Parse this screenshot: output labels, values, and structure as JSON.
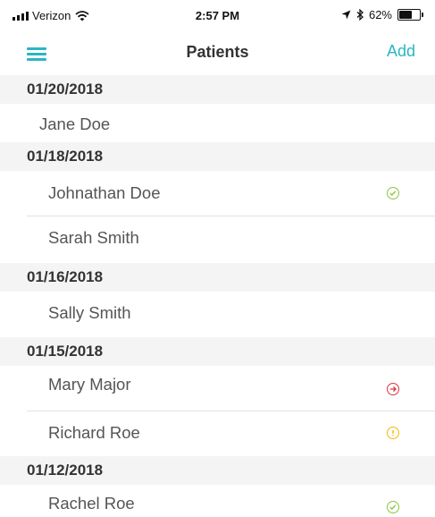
{
  "status_bar": {
    "carrier": "Verizon",
    "time": "2:57 PM",
    "battery": "62%",
    "battery_level": 0.62
  },
  "nav": {
    "title": "Patients",
    "add_label": "Add"
  },
  "sections": [
    {
      "date": "01/20/2018",
      "patients": [
        {
          "name": "Jane Doe",
          "status": "none"
        }
      ]
    },
    {
      "date": "01/18/2018",
      "patients": [
        {
          "name": "Johnathan Doe",
          "status": "check"
        },
        {
          "name": "Sarah Smith",
          "status": "none"
        }
      ]
    },
    {
      "date": "01/16/2018",
      "patients": [
        {
          "name": "Sally Smith",
          "status": "none"
        }
      ]
    },
    {
      "date": "01/15/2018",
      "patients": [
        {
          "name": "Mary Major",
          "status": "arrow"
        },
        {
          "name": "Richard Roe",
          "status": "alert"
        }
      ]
    },
    {
      "date": "01/12/2018",
      "patients": [
        {
          "name": "Rachel Roe",
          "status": "check"
        }
      ]
    }
  ],
  "colors": {
    "accent": "#2bb5c5",
    "check": "#8cc63f",
    "arrow": "#d9363e",
    "alert": "#f5b800",
    "section_bg": "#f4f4f4"
  }
}
